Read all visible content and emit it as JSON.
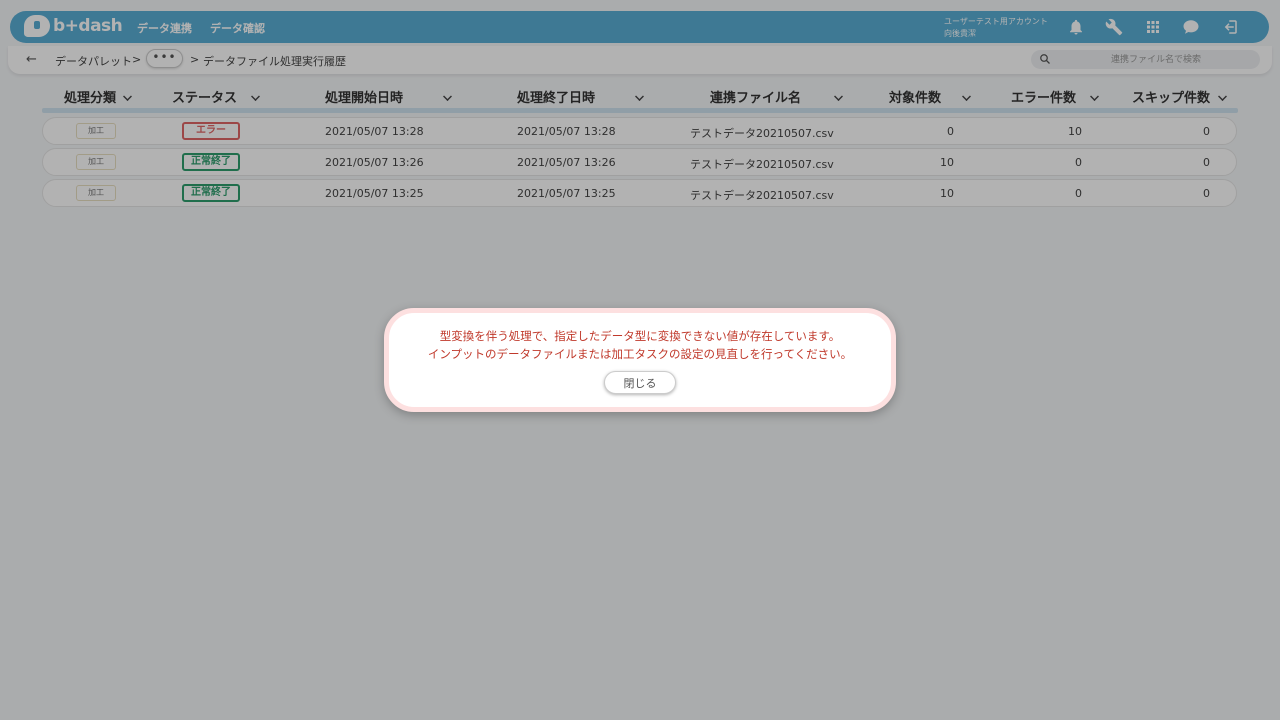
{
  "header": {
    "logo_text": "b+dash",
    "nav": [
      "データ連携",
      "データ確認"
    ],
    "account_line1": "ユーザーテスト用アカウント",
    "account_line2": "向後貴潔",
    "icons": [
      "bell-icon",
      "wrench-icon",
      "apps-grid-icon",
      "support-chat-icon",
      "logout-icon"
    ],
    "color": "#5aaed5"
  },
  "breadcrumb": {
    "back": "←",
    "first": "データパレット",
    "sep": ">",
    "more": "•••",
    "current": "データファイル処理実行履歴"
  },
  "search": {
    "placeholder": "連携ファイル名で検索"
  },
  "table": {
    "columns": [
      "処理分類",
      "ステータス",
      "処理開始日時",
      "処理終了日時",
      "連携ファイル名",
      "対象件数",
      "エラー件数",
      "スキップ件数"
    ],
    "rows": [
      {
        "category": "加工",
        "status": "エラー",
        "status_type": "error",
        "start": "2021/05/07 13:28",
        "end": "2021/05/07 13:28",
        "file": "テストデータ20210507.csv",
        "target": "0",
        "errors": "10",
        "skipped": "0"
      },
      {
        "category": "加工",
        "status": "正常終了",
        "status_type": "ok",
        "start": "2021/05/07 13:26",
        "end": "2021/05/07 13:26",
        "file": "テストデータ20210507.csv",
        "target": "10",
        "errors": "0",
        "skipped": "0"
      },
      {
        "category": "加工",
        "status": "正常終了",
        "status_type": "ok",
        "start": "2021/05/07 13:25",
        "end": "2021/05/07 13:25",
        "file": "テストデータ20210507.csv",
        "target": "10",
        "errors": "0",
        "skipped": "0"
      }
    ],
    "status_colors": {
      "error": "#e06666",
      "ok": "#2e9e6e"
    }
  },
  "modal": {
    "line1": "型変換を伴う処理で、指定したデータ型に変換できない値が存在しています。",
    "line2": "インプットのデータファイルまたは加工タスクの設定の見直しを行ってください。",
    "close_label": "閉じる"
  }
}
